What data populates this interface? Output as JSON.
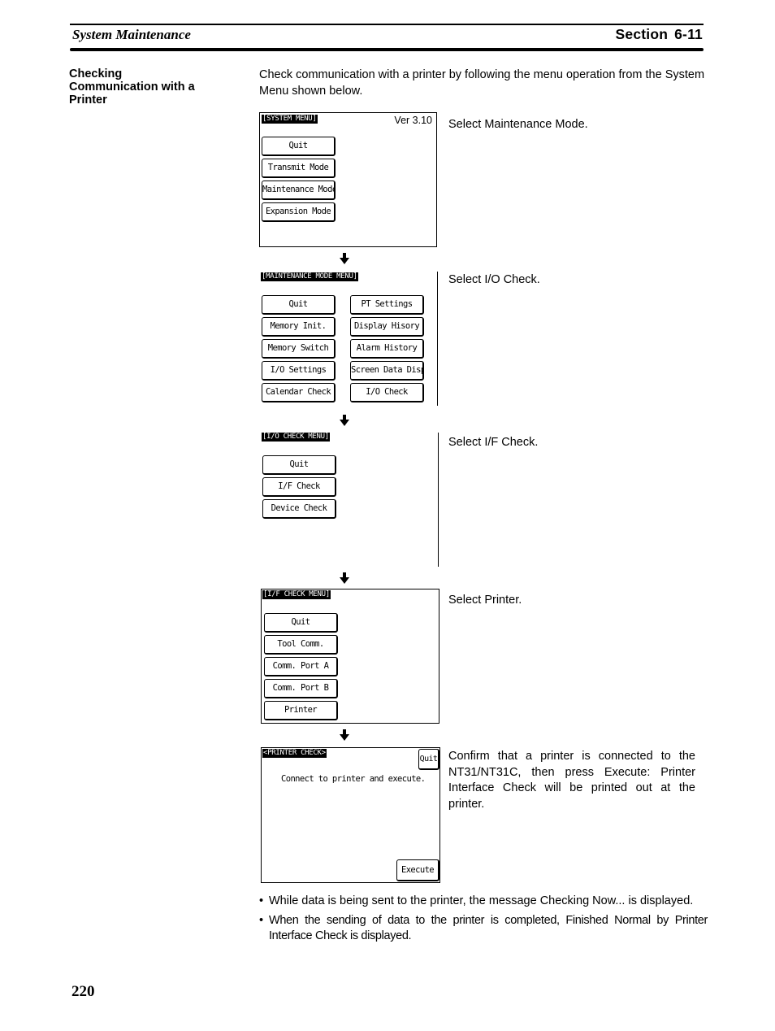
{
  "header": {
    "chapter_title": "System Maintenance",
    "section_label": "Section",
    "section_number": "6-11"
  },
  "side_heading": [
    "Checking",
    "Communication with a",
    "Printer"
  ],
  "intro_text": "Check communication with a printer by following the menu operation from the System Menu shown below.",
  "icons": {
    "flow_arrow": "down-arrow-icon"
  },
  "screens": {
    "system_menu": {
      "title": "[SYSTEM MENU]",
      "version": "Ver 3.10",
      "buttons": [
        "Quit",
        "Transmit Mode",
        "Maintenance Mode",
        "Expansion Mode"
      ],
      "description": "Select Maintenance Mode."
    },
    "maintenance_menu": {
      "title": "[MAINTENANCE MODE MENU]",
      "left_buttons": [
        "Quit",
        "Memory Init.",
        "Memory Switch",
        "I/O Settings",
        "Calendar Check"
      ],
      "right_buttons": [
        "PT Settings",
        "Display Hisory",
        "Alarm History",
        "Screen Data Disp.",
        "I/O Check"
      ],
      "description": "Select I/O Check."
    },
    "io_check_menu": {
      "title": "[I/O CHECK MENU]",
      "buttons": [
        "Quit",
        "I/F Check",
        "Device Check"
      ],
      "description": "Select I/F Check."
    },
    "if_check_menu": {
      "title": "[I/F CHECK MENU]",
      "buttons": [
        "Quit",
        "Tool Comm.",
        "Comm. Port A",
        "Comm. Port B",
        "Printer"
      ],
      "description": "Select Printer."
    },
    "printer_check": {
      "title": "<PRINTER CHECK>",
      "quit_label": "Quit",
      "message": "Connect to printer and execute.",
      "execute_label": "Execute",
      "description": "Confirm that a printer is connected to the NT31/NT31C, then press Execute: Printer Interface Check will be printed out at the printer."
    }
  },
  "bullets": [
    "While data is being sent to the printer, the message Checking Now... is displayed.",
    "When the sending of data to the printer is completed, Finished Normal by Printer Interface Check is displayed."
  ],
  "bullet_symbol": "•",
  "page_number": "220"
}
